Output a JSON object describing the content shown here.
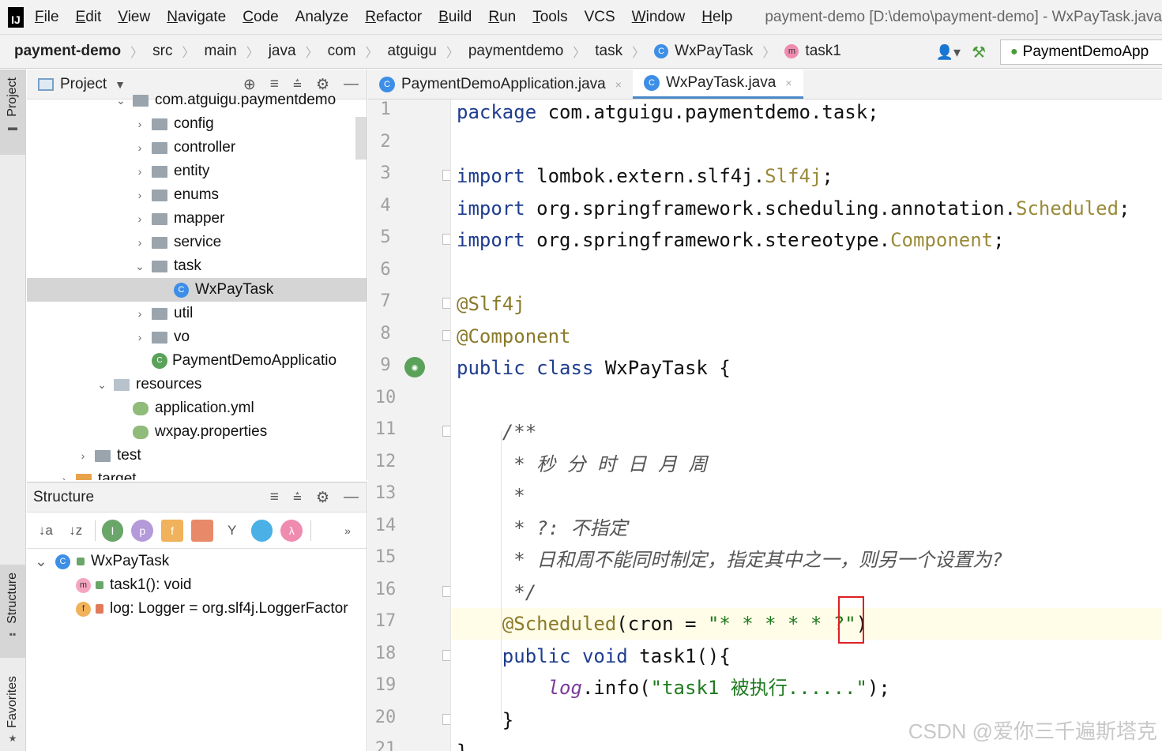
{
  "menubar": {
    "items": [
      {
        "mn": "F",
        "rest": "ile"
      },
      {
        "mn": "E",
        "rest": "dit"
      },
      {
        "mn": "V",
        "rest": "iew"
      },
      {
        "mn": "N",
        "rest": "avigate"
      },
      {
        "mn": "C",
        "rest": "ode"
      },
      {
        "mn": "",
        "rest": "Analyze"
      },
      {
        "mn": "R",
        "rest": "efactor"
      },
      {
        "mn": "B",
        "rest": "uild"
      },
      {
        "mn": "R",
        "rest": "un"
      },
      {
        "mn": "T",
        "rest": "ools"
      },
      {
        "mn": "",
        "rest": "VCS"
      },
      {
        "mn": "W",
        "rest": "indow"
      },
      {
        "mn": "H",
        "rest": "elp"
      }
    ],
    "title": "payment-demo [D:\\demo\\payment-demo] - WxPayTask.java"
  },
  "navbar": {
    "crumbs": [
      "payment-demo",
      "src",
      "main",
      "java",
      "com",
      "atguigu",
      "paymentdemo",
      "task",
      "WxPayTask",
      "task1"
    ],
    "run_config": "PaymentDemoApp"
  },
  "sidebar_tabs": {
    "project": "Project",
    "structure": "Structure",
    "favorites": "Favorites"
  },
  "project_panel": {
    "title": "Project",
    "tree": [
      {
        "label": "com.atguigu.paymentdemo",
        "kind": "folder",
        "depth": 3,
        "arrow": "v"
      },
      {
        "label": "config",
        "kind": "folder",
        "depth": 4,
        "arrow": ">"
      },
      {
        "label": "controller",
        "kind": "folder",
        "depth": 4,
        "arrow": ">"
      },
      {
        "label": "entity",
        "kind": "folder",
        "depth": 4,
        "arrow": ">"
      },
      {
        "label": "enums",
        "kind": "folder",
        "depth": 4,
        "arrow": ">"
      },
      {
        "label": "mapper",
        "kind": "folder",
        "depth": 4,
        "arrow": ">"
      },
      {
        "label": "service",
        "kind": "folder",
        "depth": 4,
        "arrow": ">"
      },
      {
        "label": "task",
        "kind": "folder",
        "depth": 4,
        "arrow": "v"
      },
      {
        "label": "WxPayTask",
        "kind": "class",
        "depth": 5,
        "arrow": "",
        "selected": true
      },
      {
        "label": "util",
        "kind": "folder",
        "depth": 4,
        "arrow": ">"
      },
      {
        "label": "vo",
        "kind": "folder",
        "depth": 4,
        "arrow": ">"
      },
      {
        "label": "PaymentDemoApplicatio",
        "kind": "spring",
        "depth": 4,
        "arrow": ""
      },
      {
        "label": "resources",
        "kind": "folder-light",
        "depth": 2,
        "arrow": "v"
      },
      {
        "label": "application.yml",
        "kind": "yml",
        "depth": 3,
        "arrow": ""
      },
      {
        "label": "wxpay.properties",
        "kind": "yml",
        "depth": 3,
        "arrow": ""
      },
      {
        "label": "test",
        "kind": "folder",
        "depth": 1,
        "arrow": ">"
      },
      {
        "label": "target",
        "kind": "folder-orange",
        "depth": 0,
        "arrow": ">"
      }
    ]
  },
  "structure_panel": {
    "title": "Structure",
    "toolbar_glyphs": [
      "↓a",
      "↓z",
      "I",
      "p",
      "f",
      "",
      "Y",
      "",
      "λ"
    ],
    "nodes": [
      {
        "label": "WxPayTask",
        "icon": "C",
        "depth": 0
      },
      {
        "label": "task1(): void",
        "icon": "m",
        "depth": 1
      },
      {
        "label": "log: Logger = org.slf4j.LoggerFactor",
        "icon": "f",
        "depth": 1
      }
    ]
  },
  "editor": {
    "tabs": [
      {
        "label": "PaymentDemoApplication.java",
        "active": false
      },
      {
        "label": "WxPayTask.java",
        "active": true
      }
    ],
    "lines": [
      {
        "n": "1",
        "tokens": [
          {
            "t": "package",
            "c": "kw"
          },
          {
            "t": " com.atguigu.paymentdemo.task;",
            "c": ""
          }
        ]
      },
      {
        "n": "2",
        "tokens": []
      },
      {
        "n": "3",
        "tokens": [
          {
            "t": "import",
            "c": "kw"
          },
          {
            "t": " lombok.extern.slf4j.",
            "c": ""
          },
          {
            "t": "Slf4j",
            "c": "imp"
          },
          {
            "t": ";",
            "c": ""
          }
        ]
      },
      {
        "n": "4",
        "tokens": [
          {
            "t": "import",
            "c": "kw"
          },
          {
            "t": " org.springframework.scheduling.annotation.",
            "c": ""
          },
          {
            "t": "Scheduled",
            "c": "imp"
          },
          {
            "t": ";",
            "c": ""
          }
        ]
      },
      {
        "n": "5",
        "tokens": [
          {
            "t": "import",
            "c": "kw"
          },
          {
            "t": " org.springframework.stereotype.",
            "c": ""
          },
          {
            "t": "Component",
            "c": "imp"
          },
          {
            "t": ";",
            "c": ""
          }
        ]
      },
      {
        "n": "6",
        "tokens": []
      },
      {
        "n": "7",
        "tokens": [
          {
            "t": "@Slf4j",
            "c": "ann"
          }
        ]
      },
      {
        "n": "8",
        "tokens": [
          {
            "t": "@Component",
            "c": "ann"
          }
        ]
      },
      {
        "n": "9",
        "tokens": [
          {
            "t": "public class",
            "c": "kw"
          },
          {
            "t": " WxPayTask {",
            "c": ""
          }
        ]
      },
      {
        "n": "10",
        "tokens": []
      },
      {
        "n": "11",
        "tokens": [
          {
            "t": "    /**",
            "c": "cm"
          }
        ]
      },
      {
        "n": "12",
        "tokens": [
          {
            "t": "     * 秒 分 时 日 月 周",
            "c": "cm"
          }
        ]
      },
      {
        "n": "13",
        "tokens": [
          {
            "t": "     *",
            "c": "cm"
          }
        ]
      },
      {
        "n": "14",
        "tokens": [
          {
            "t": "     * ?: 不指定",
            "c": "cm"
          }
        ]
      },
      {
        "n": "15",
        "tokens": [
          {
            "t": "     * 日和周不能同时制定，指定其中之一，则另一个设置为?",
            "c": "cm"
          }
        ]
      },
      {
        "n": "16",
        "tokens": [
          {
            "t": "     */",
            "c": "cm"
          }
        ]
      },
      {
        "n": "17",
        "tokens": [
          {
            "t": "    @Scheduled",
            "c": "ann"
          },
          {
            "t": "(cron = ",
            "c": ""
          },
          {
            "t": "\"* * * * * ?\"",
            "c": "str"
          },
          {
            "t": ")",
            "c": ""
          }
        ]
      },
      {
        "n": "18",
        "tokens": [
          {
            "t": "    public void",
            "c": "kw"
          },
          {
            "t": " task1(){",
            "c": ""
          }
        ]
      },
      {
        "n": "19",
        "tokens": [
          {
            "t": "        ",
            "c": ""
          },
          {
            "t": "log",
            "c": "fld"
          },
          {
            "t": ".info(",
            "c": ""
          },
          {
            "t": "\"task1 被执行......\"",
            "c": "str"
          },
          {
            "t": ");",
            "c": ""
          }
        ]
      },
      {
        "n": "20",
        "tokens": [
          {
            "t": "    }",
            "c": ""
          }
        ]
      },
      {
        "n": "21",
        "tokens": [
          {
            "t": "}",
            "c": ""
          }
        ]
      }
    ]
  },
  "watermark": "CSDN @爱你三千遍斯塔克"
}
